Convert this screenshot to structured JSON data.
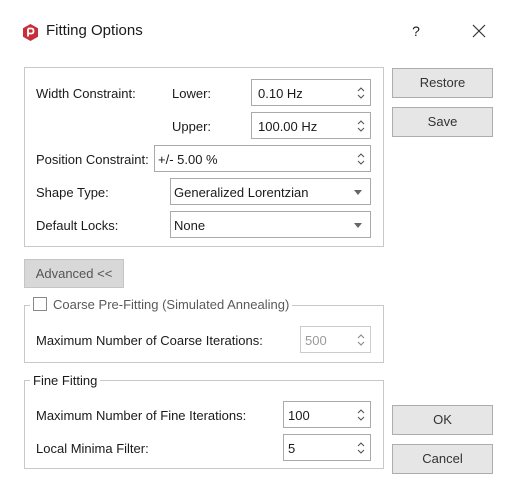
{
  "window": {
    "title": "Fitting Options",
    "help_label": "?"
  },
  "constraints": {
    "width_label": "Width Constraint:",
    "lower_label": "Lower:",
    "lower_value": "0.10 Hz",
    "upper_label": "Upper:",
    "upper_value": "100.00 Hz",
    "position_label": "Position Constraint:",
    "position_value": "+/- 5.00 %",
    "shape_label": "Shape Type:",
    "shape_value": "Generalized Lorentzian",
    "locks_label": "Default Locks:",
    "locks_value": "None"
  },
  "buttons": {
    "restore": "Restore",
    "save": "Save",
    "advanced": "Advanced <<",
    "ok": "OK",
    "cancel": "Cancel"
  },
  "coarse": {
    "legend": "Coarse Pre-Fitting (Simulated Annealing)",
    "checked": false,
    "iterations_label": "Maximum Number of Coarse Iterations:",
    "iterations_value": "500"
  },
  "fine": {
    "legend": "Fine Fitting",
    "iterations_label": "Maximum Number of Fine Iterations:",
    "iterations_value": "100",
    "minima_label": "Local Minima Filter:",
    "minima_value": "5"
  },
  "icons": {
    "app": "app-logo-icon",
    "close": "close-icon",
    "spin": "spin-arrows-icon",
    "dropdown": "chevron-down-icon"
  },
  "colors": {
    "app_icon": "#c62f3a"
  }
}
